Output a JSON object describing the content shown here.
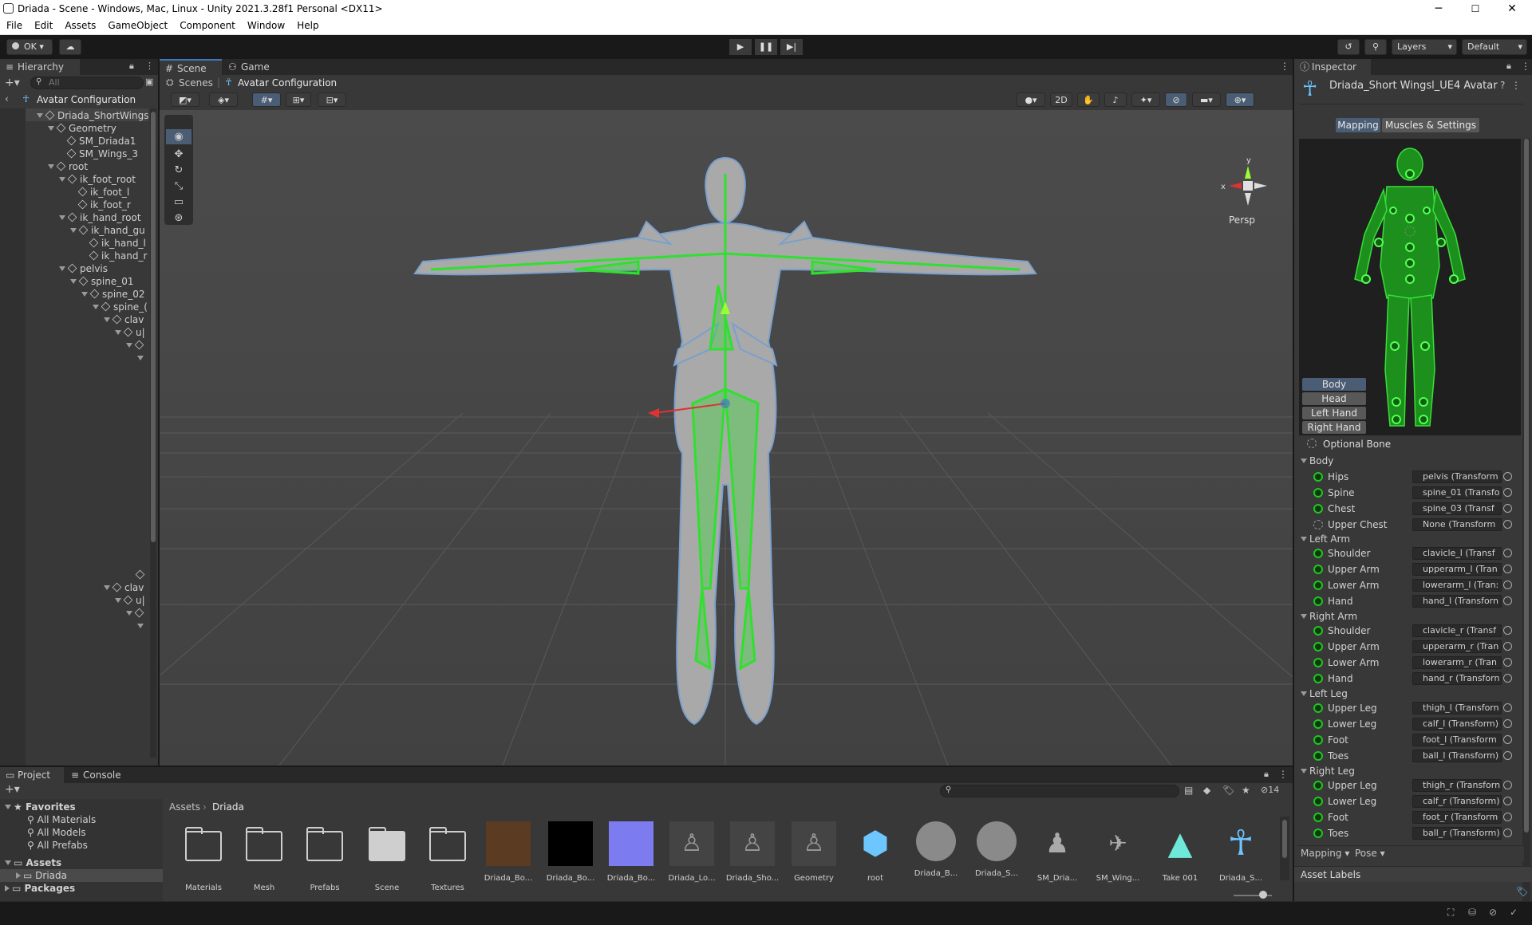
{
  "window": {
    "title": "Driada - Scene - Windows, Mac, Linux - Unity 2021.3.28f1 Personal <DX11>",
    "controls": [
      "─",
      "☐",
      "✕"
    ]
  },
  "menu": [
    "File",
    "Edit",
    "Assets",
    "GameObject",
    "Component",
    "Window",
    "Help"
  ],
  "toolbar": {
    "account": "OK",
    "layers": "Layers",
    "layout": "Default"
  },
  "hierarchy": {
    "tab": "Hierarchy",
    "search_placeholder": "All",
    "header": "Avatar Configuration",
    "rows": [
      {
        "label": "Driada_ShortWings"
      },
      {
        "label": "Geometry"
      },
      {
        "label": "SM_Driada1"
      },
      {
        "label": "SM_Wings_3"
      },
      {
        "label": "root"
      },
      {
        "label": "ik_foot_root"
      },
      {
        "label": "ik_foot_l"
      },
      {
        "label": "ik_foot_r"
      },
      {
        "label": "ik_hand_root"
      },
      {
        "label": "ik_hand_gu"
      },
      {
        "label": "ik_hand_l"
      },
      {
        "label": "ik_hand_r"
      },
      {
        "label": "pelvis"
      },
      {
        "label": "spine_01"
      },
      {
        "label": "spine_02"
      },
      {
        "label": "spine_("
      },
      {
        "label": "clav"
      },
      {
        "label": "u|"
      },
      {
        "label": ""
      },
      {
        "label": ""
      },
      {
        "label": ""
      },
      {
        "label": "clav"
      },
      {
        "label": "u|"
      },
      {
        "label": ""
      },
      {
        "label": ""
      }
    ]
  },
  "scene": {
    "tabs": [
      "Scene",
      "Game"
    ],
    "breadcrumb": [
      "Scenes",
      "Avatar Configuration"
    ],
    "toggle_2d": "2D",
    "persp": "Persp",
    "gizmo_x": "x",
    "gizmo_y": "y"
  },
  "inspector": {
    "tab": "Inspector",
    "title": "Driada_Short Wingsl_UE4 Avatar",
    "tabs": [
      "Mapping",
      "Muscles & Settings"
    ],
    "body_buttons": [
      "Body",
      "Head",
      "Left Hand",
      "Right Hand"
    ],
    "optional_bone": "Optional Bone",
    "sections": [
      {
        "name": "Body",
        "bones": [
          {
            "label": "Hips",
            "value": "pelvis (Transform",
            "required": true
          },
          {
            "label": "Spine",
            "value": "spine_01 (Transfo",
            "required": true
          },
          {
            "label": "Chest",
            "value": "spine_03 (Transf",
            "required": false
          },
          {
            "label": "Upper Chest",
            "value": "None (Transform",
            "required": false
          }
        ]
      },
      {
        "name": "Left Arm",
        "bones": [
          {
            "label": "Shoulder",
            "value": "clavicle_l (Transf",
            "required": false
          },
          {
            "label": "Upper Arm",
            "value": "upperarm_l (Tran",
            "required": true
          },
          {
            "label": "Lower Arm",
            "value": "lowerarm_l (Tran:",
            "required": true
          },
          {
            "label": "Hand",
            "value": "hand_l (Transforn",
            "required": true
          }
        ]
      },
      {
        "name": "Right Arm",
        "bones": [
          {
            "label": "Shoulder",
            "value": "clavicle_r (Transf",
            "required": false
          },
          {
            "label": "Upper Arm",
            "value": "upperarm_r (Tran",
            "required": true
          },
          {
            "label": "Lower Arm",
            "value": "lowerarm_r (Tran",
            "required": true
          },
          {
            "label": "Hand",
            "value": "hand_r (Transforn",
            "required": true
          }
        ]
      },
      {
        "name": "Left Leg",
        "bones": [
          {
            "label": "Upper Leg",
            "value": "thigh_l (Transforn",
            "required": true
          },
          {
            "label": "Lower Leg",
            "value": "calf_l (Transform)",
            "required": true
          },
          {
            "label": "Foot",
            "value": "foot_l (Transform",
            "required": true
          },
          {
            "label": "Toes",
            "value": "ball_l (Transform)",
            "required": false
          }
        ]
      },
      {
        "name": "Right Leg",
        "bones": [
          {
            "label": "Upper Leg",
            "value": "thigh_r (Transforn",
            "required": true
          },
          {
            "label": "Lower Leg",
            "value": "calf_r (Transform)",
            "required": true
          },
          {
            "label": "Foot",
            "value": "foot_r (Transform",
            "required": true
          },
          {
            "label": "Toes",
            "value": "ball_r (Transform)",
            "required": false
          }
        ]
      }
    ],
    "footer_buttons": [
      "Mapping",
      "Pose"
    ],
    "asset_labels": "Asset Labels"
  },
  "project": {
    "tabs": [
      "Project",
      "Console"
    ],
    "hidden_count": "14",
    "favorites": {
      "label": "Favorites",
      "items": [
        "All Materials",
        "All Models",
        "All Prefabs"
      ]
    },
    "tree": {
      "assets": "Assets",
      "driada": "Driada",
      "packages": "Packages"
    },
    "breadcrumb": [
      "Assets",
      "Driada"
    ],
    "assets": [
      {
        "label": "Materials",
        "kind": "folder"
      },
      {
        "label": "Mesh",
        "kind": "folder"
      },
      {
        "label": "Prefabs",
        "kind": "folder"
      },
      {
        "label": "Scene",
        "kind": "folder-filled"
      },
      {
        "label": "Textures",
        "kind": "folder"
      },
      {
        "label": "Driada_Bo...",
        "kind": "texture-brown"
      },
      {
        "label": "Driada_Bo...",
        "kind": "texture-black"
      },
      {
        "label": "Driada_Bo...",
        "kind": "texture-normal"
      },
      {
        "label": "Driada_Lo...",
        "kind": "model"
      },
      {
        "label": "Driada_Sho...",
        "kind": "model"
      },
      {
        "label": "Geometry",
        "kind": "model"
      },
      {
        "label": "root",
        "kind": "prefab-cube"
      },
      {
        "label": "Driada_B...",
        "kind": "sphere"
      },
      {
        "label": "Driada_S...",
        "kind": "sphere"
      },
      {
        "label": "SM_Dria...",
        "kind": "mesh-figure"
      },
      {
        "label": "SM_Wing...",
        "kind": "mesh-wing"
      },
      {
        "label": "Take 001",
        "kind": "anim"
      },
      {
        "label": "Driada_S...",
        "kind": "avatar"
      }
    ]
  },
  "colors": {
    "accent": "#3a79bb",
    "bone_green": "#21c421",
    "panel": "#383838",
    "scene_bg": "#464646"
  }
}
